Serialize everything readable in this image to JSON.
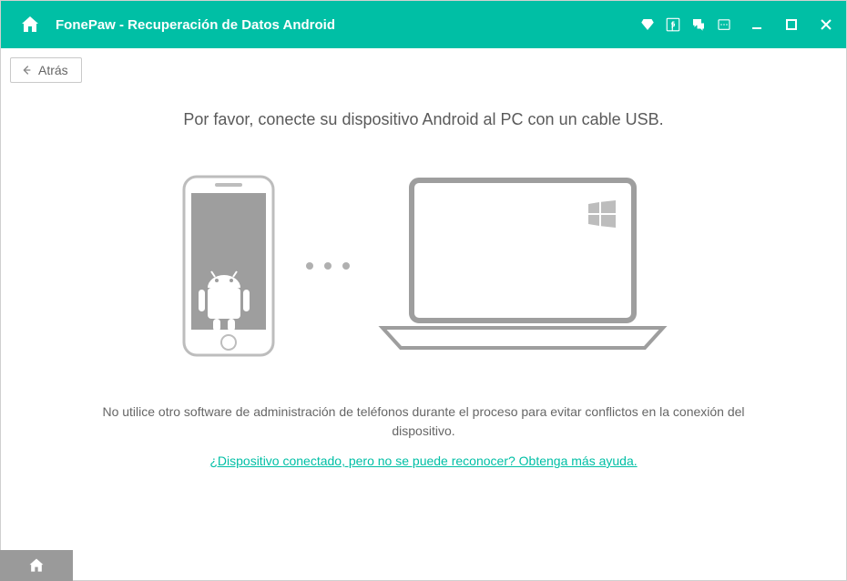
{
  "header": {
    "title": "FonePaw - Recuperación de Datos Android"
  },
  "toolbar": {
    "back_label": "Atrás"
  },
  "main": {
    "heading": "Por favor, conecte su dispositivo Android al PC con un cable USB.",
    "warning": "No utilice otro software de administración de teléfonos durante el proceso para evitar conflictos en la conexión del dispositivo.",
    "help_link": "¿Dispositivo conectado, pero no se puede reconocer? Obtenga más ayuda."
  }
}
